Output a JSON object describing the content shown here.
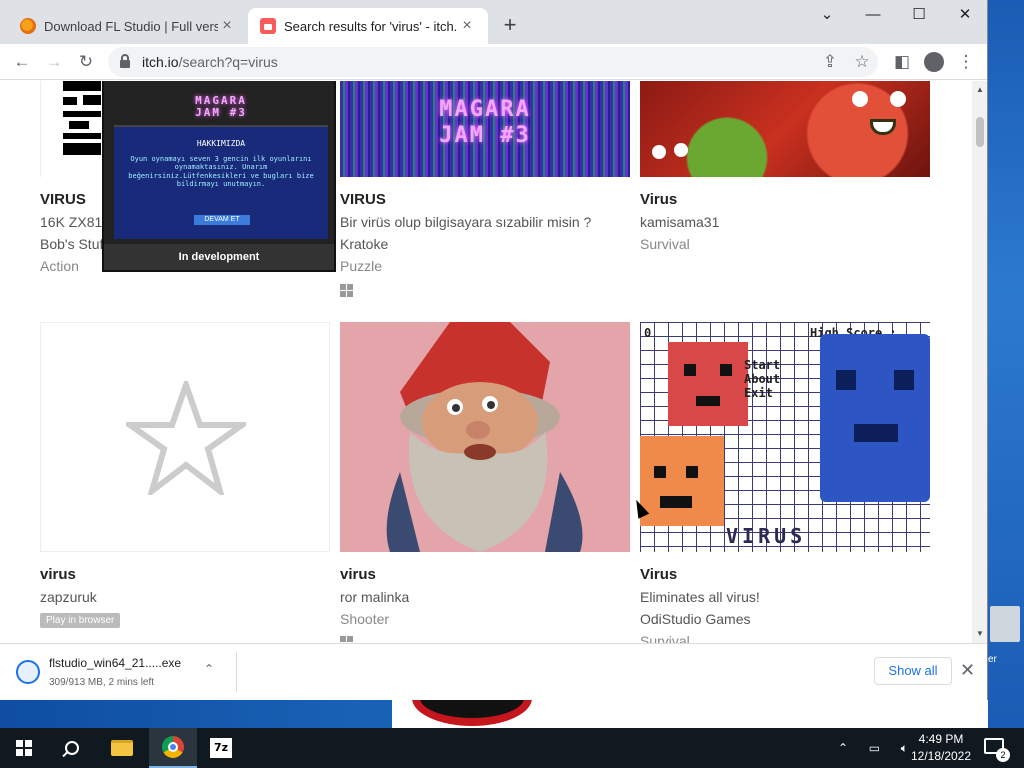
{
  "browser": {
    "tabs": [
      {
        "title": "Download FL Studio | Full version",
        "active": false
      },
      {
        "title": "Search results for 'virus' - itch.io",
        "active": true
      }
    ],
    "url_host": "itch.io",
    "url_path": "/search?q=virus"
  },
  "popup": {
    "jam_title_line1": "MAGARA",
    "jam_title_line2": "JAM #3",
    "heading": "HAKKIMIZDA",
    "body": "Oyun oynamayı seven 3 gencin ilk oyunlarını oynamaktasınız. Unarım beğenirsiniz.Lütfenkesikleri ve bugları bize bildirmayı unutmayın.",
    "button": "DEVAM ET",
    "status": "In development"
  },
  "games_row1": [
    {
      "title": "VIRUS",
      "desc": "16K ZX81",
      "author": "Bob's Stuff",
      "genre": "Action",
      "windows": false
    },
    {
      "title": "VIRUS",
      "desc": "Bir virüs olup bilgisayara sızabilir misin ?",
      "author": "Kratoke",
      "genre": "Puzzle",
      "windows": true,
      "thumb_line1": "MAGARA",
      "thumb_line2": "JAM #3"
    },
    {
      "title": "Virus",
      "desc": "",
      "author": "kamisama31",
      "genre": "Survival",
      "windows": false
    }
  ],
  "games_row2": [
    {
      "title": "virus",
      "author": "zapzuruk",
      "badge": "Play in browser"
    },
    {
      "title": "virus",
      "author": "ror malinka",
      "genre": "Shooter",
      "windows": true
    },
    {
      "title": "Virus",
      "desc": "Eliminates all virus!",
      "author": "OdiStudio Games",
      "genre": "Survival",
      "thumb_score": "High Score :",
      "thumb_zero": "0",
      "thumb_menu": [
        "Start",
        "About",
        "Exit"
      ],
      "thumb_logo": "VIRUS"
    }
  ],
  "downloads": {
    "filename": "flstudio_win64_21.....exe",
    "progress": "309/913 MB, 2 mins left",
    "show_all": "Show all"
  },
  "taskbar": {
    "time": "4:49 PM",
    "date": "12/18/2022",
    "notifications": "2",
    "zip_app": "7z"
  },
  "desktop": {
    "icon_label": "er"
  }
}
